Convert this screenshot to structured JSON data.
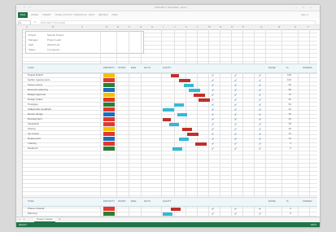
{
  "window": {
    "title": "PROJECT TRACKER - Excel"
  },
  "qat": {
    "items": [
      "save",
      "undo",
      "redo",
      "more"
    ]
  },
  "ribbon": {
    "file_label": "FILE",
    "tabs": [
      "HOME",
      "INSERT",
      "PAGE LAYOUT",
      "FORMULAS",
      "DATA",
      "REVIEW",
      "VIEW"
    ],
    "signin": "Sign in"
  },
  "formula": {
    "namebox": "A1",
    "fx": "fx",
    "content": "PROJECT TRACKER"
  },
  "columns": [
    "A",
    "B",
    "C",
    "D",
    "E",
    "F",
    "G",
    "H",
    "I",
    "J",
    "K",
    "L",
    "M",
    "N",
    "O",
    "P",
    "Q",
    "R",
    "S",
    "T"
  ],
  "info": {
    "rows": [
      {
        "k": "Project",
        "v": "Sample Project"
      },
      {
        "k": "Manager",
        "v": "Project Lead"
      },
      {
        "k": "Start",
        "v": "2024-01-01"
      },
      {
        "k": "Status",
        "v": "In progress"
      }
    ]
  },
  "table": {
    "headers": [
      "TASK",
      "PRIORITY",
      "START",
      "END",
      "DAYS",
      "GANTT",
      "DONE",
      "%",
      "OWNER"
    ],
    "rows": [
      {
        "name": "Project kickoff",
        "prio": "#f2c200",
        "g1": 10,
        "g2": 20,
        "gc": "#c0302a",
        "c": "✔",
        "p": "100"
      },
      {
        "name": "Gather requirements",
        "prio": "#e0392f",
        "g1": 20,
        "g2": 34,
        "gc": "#c0302a",
        "c": "✔",
        "p": "100"
      },
      {
        "name": "Scope review",
        "prio": "#2e7d32",
        "g1": 26,
        "g2": 38,
        "gc": "#33b9d6",
        "c": "✔",
        "p": "90"
      },
      {
        "name": "Resource planning",
        "prio": "#1e6fb8",
        "g1": 32,
        "g2": 46,
        "gc": "#33b9d6",
        "c": "✔",
        "p": "80"
      },
      {
        "name": "Budget approval",
        "prio": "#f2c200",
        "g1": 38,
        "g2": 52,
        "gc": "#c0302a",
        "c": "✔",
        "p": "75"
      },
      {
        "name": "Design phase",
        "prio": "#e0392f",
        "g1": 44,
        "g2": 58,
        "gc": "#c0302a",
        "c": "✔",
        "p": "60"
      },
      {
        "name": "Prototype",
        "prio": "#2e7d32",
        "g1": 14,
        "g2": 26,
        "gc": "#33b9d6",
        "c": "✔",
        "p": "50"
      },
      {
        "name": "Stakeholder feedback",
        "prio": "#e0392f",
        "g1": 0,
        "g2": 14,
        "gc": "#33b9d6",
        "c": "✔",
        "p": "40"
      },
      {
        "name": "Revise design",
        "prio": "#1e6fb8",
        "g1": 18,
        "g2": 30,
        "gc": "#33b9d6",
        "c": "✔",
        "p": "35"
      },
      {
        "name": "Development",
        "prio": "#e0392f",
        "g1": 0,
        "g2": 10,
        "gc": "#c0302a",
        "c": "✔",
        "p": "30"
      },
      {
        "name": "Integration",
        "prio": "#e0392f",
        "g1": 8,
        "g2": 20,
        "gc": "#33b9d6",
        "c": "✔",
        "p": "25"
      },
      {
        "name": "Testing",
        "prio": "#f2c200",
        "g1": 24,
        "g2": 36,
        "gc": "#c0302a",
        "c": "✔",
        "p": "20"
      },
      {
        "name": "QA review",
        "prio": "#e0392f",
        "g1": 30,
        "g2": 44,
        "gc": "#c0302a",
        "c": "✔",
        "p": "15"
      },
      {
        "name": "Deployment",
        "prio": "#1e6fb8",
        "g1": 20,
        "g2": 32,
        "gc": "#33b9d6",
        "c": "✔",
        "p": "10"
      },
      {
        "name": "Training",
        "prio": "#e0392f",
        "g1": 40,
        "g2": 54,
        "gc": "#c0302a",
        "c": "✔",
        "p": "5"
      },
      {
        "name": "Handover",
        "prio": "#2e7d32",
        "g1": 12,
        "g2": 24,
        "gc": "#33b9d6",
        "c": "✔",
        "p": "0"
      }
    ]
  },
  "table2": {
    "headers": [
      "TASK",
      "PRIORITY",
      "START",
      "END",
      "DAYS",
      "GANTT",
      "DONE",
      "%",
      "OWNER"
    ],
    "rows": [
      {
        "name": "Phase 2 kickoff",
        "prio": "#e0392f",
        "g1": 10,
        "g2": 22,
        "gc": "#c0302a",
        "c": "✔",
        "p": "0"
      },
      {
        "name": "Planning",
        "prio": "#2e7d32",
        "g1": 0,
        "g2": 12,
        "gc": "#33b9d6",
        "c": "✔",
        "p": "0"
      },
      {
        "name": "Review",
        "prio": "#1e6fb8",
        "g1": 30,
        "g2": 44,
        "gc": "#c0302a",
        "c": "✔",
        "p": "0"
      }
    ]
  },
  "sheet": {
    "tab": "Project Tracker"
  },
  "status": {
    "text": "READY",
    "zoom": "100%"
  }
}
